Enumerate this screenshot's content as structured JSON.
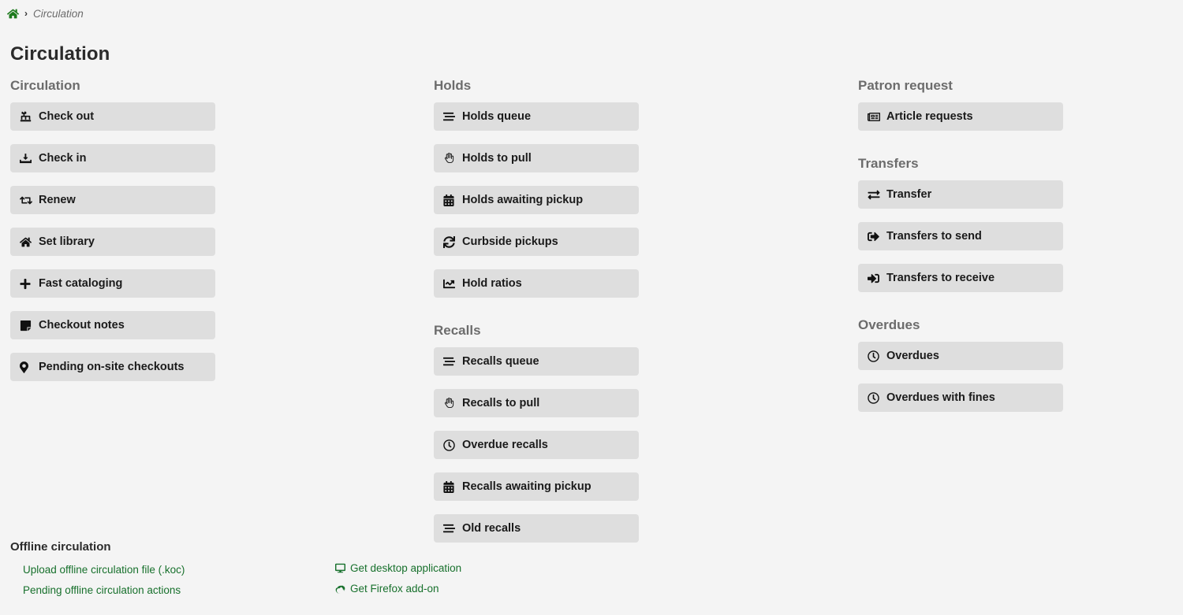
{
  "breadcrumb": {
    "home_icon": "home-icon",
    "separator": "›",
    "current": "Circulation"
  },
  "page": {
    "title": "Circulation"
  },
  "columns": [
    {
      "id": "column-left",
      "sections": [
        {
          "id": "circulation",
          "heading": "Circulation",
          "items": [
            {
              "label": "Check out",
              "icon": "upload-icon"
            },
            {
              "label": "Check in",
              "icon": "download-icon"
            },
            {
              "label": "Renew",
              "icon": "retweet-icon"
            },
            {
              "label": "Set library",
              "icon": "home-icon"
            },
            {
              "label": "Fast cataloging",
              "icon": "plus-icon"
            },
            {
              "label": "Checkout notes",
              "icon": "sticky-note-icon"
            },
            {
              "label": "Pending on-site checkouts",
              "icon": "map-marker-icon"
            }
          ]
        }
      ]
    },
    {
      "id": "column-middle",
      "sections": [
        {
          "id": "holds",
          "heading": "Holds",
          "items": [
            {
              "label": "Holds queue",
              "icon": "stream-icon"
            },
            {
              "label": "Holds to pull",
              "icon": "hand-icon"
            },
            {
              "label": "Holds awaiting pickup",
              "icon": "calendar-icon"
            },
            {
              "label": "Curbside pickups",
              "icon": "sync-icon"
            },
            {
              "label": "Hold ratios",
              "icon": "chart-line-icon"
            }
          ]
        },
        {
          "id": "recalls",
          "heading": "Recalls",
          "items": [
            {
              "label": "Recalls queue",
              "icon": "stream-icon"
            },
            {
              "label": "Recalls to pull",
              "icon": "hand-icon"
            },
            {
              "label": "Overdue recalls",
              "icon": "clock-icon"
            },
            {
              "label": "Recalls awaiting pickup",
              "icon": "calendar-icon"
            },
            {
              "label": "Old recalls",
              "icon": "stream-icon"
            }
          ]
        }
      ]
    },
    {
      "id": "column-right",
      "sections": [
        {
          "id": "patron-request",
          "heading": "Patron request",
          "items": [
            {
              "label": "Article requests",
              "icon": "newspaper-icon"
            }
          ]
        },
        {
          "id": "transfers",
          "heading": "Transfers",
          "items": [
            {
              "label": "Transfer",
              "icon": "exchange-icon"
            },
            {
              "label": "Transfers to send",
              "icon": "sign-out-icon"
            },
            {
              "label": "Transfers to receive",
              "icon": "sign-in-icon"
            }
          ]
        },
        {
          "id": "overdues",
          "heading": "Overdues",
          "items": [
            {
              "label": "Overdues",
              "icon": "clock-icon"
            },
            {
              "label": "Overdues with fines",
              "icon": "clock-icon"
            }
          ]
        }
      ]
    }
  ],
  "offline": {
    "heading": "Offline circulation",
    "left_links": [
      {
        "label": "Upload offline circulation file (.koc)",
        "icon": null
      },
      {
        "label": "Pending offline circulation actions",
        "icon": null
      }
    ],
    "right_links": [
      {
        "label": "Get desktop application",
        "icon": "desktop-icon"
      },
      {
        "label": "Get Firefox add-on",
        "icon": "firefox-icon"
      }
    ]
  },
  "colors": {
    "background": "#f4f4f4",
    "tile": "#dedede",
    "heading": "#6c6c6c",
    "title": "#2b2b2b",
    "link_green": "#17702c",
    "home_green": "#1d7a1d"
  }
}
